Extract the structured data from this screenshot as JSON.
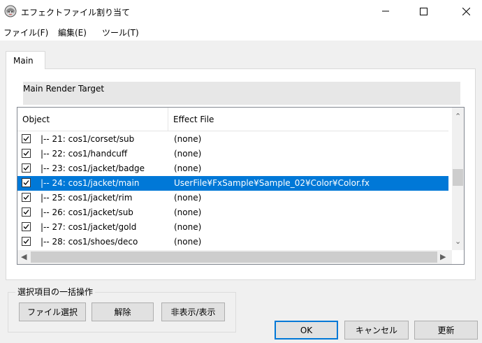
{
  "window": {
    "title": "エフェクトファイル割り当て"
  },
  "menu": [
    {
      "label": "ファイル(F)"
    },
    {
      "label": "編集(E)"
    },
    {
      "label": "ツール(T)"
    }
  ],
  "tab": {
    "label": "Main"
  },
  "render_target": {
    "label": "Main Render Target"
  },
  "list": {
    "headers": {
      "object": "Object",
      "effect": "Effect File"
    },
    "rows": [
      {
        "object": "|-- 21: cos1/corset/sub",
        "effect": "(none)",
        "checked": true,
        "selected": false
      },
      {
        "object": "|-- 22: cos1/handcuff",
        "effect": "(none)",
        "checked": true,
        "selected": false
      },
      {
        "object": "|-- 23: cos1/jacket/badge",
        "effect": "(none)",
        "checked": true,
        "selected": false
      },
      {
        "object": "|-- 24: cos1/jacket/main",
        "effect": "UserFile¥FxSample¥Sample_02¥Color¥Color.fx",
        "checked": true,
        "selected": true
      },
      {
        "object": "|-- 25: cos1/jacket/rim",
        "effect": "(none)",
        "checked": true,
        "selected": false
      },
      {
        "object": "|-- 26: cos1/jacket/sub",
        "effect": "(none)",
        "checked": true,
        "selected": false
      },
      {
        "object": "|-- 27: cos1/jacket/gold",
        "effect": "(none)",
        "checked": true,
        "selected": false
      },
      {
        "object": "|-- 28: cos1/shoes/deco",
        "effect": "(none)",
        "checked": true,
        "selected": false
      }
    ]
  },
  "bulk": {
    "label": "選択項目の一括操作",
    "select_file": "ファイル選択",
    "clear": "解除",
    "toggle_visibility": "非表示/表示"
  },
  "footer": {
    "ok": "OK",
    "cancel": "キャンセル",
    "update": "更新"
  },
  "colors": {
    "selection": "#0078d7",
    "window_bg": "#f0f0f0"
  }
}
